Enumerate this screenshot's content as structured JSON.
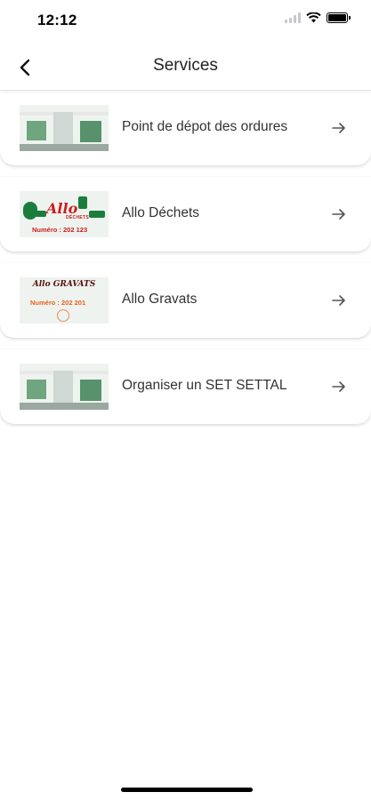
{
  "status_bar": {
    "time": "12:12"
  },
  "nav": {
    "title": "Services"
  },
  "services": [
    {
      "label": "Point de dépot des ordures",
      "icon": "arrow-right-icon"
    },
    {
      "label": "Allo Déchets",
      "icon": "arrow-right-icon",
      "thumb_text": "Allo",
      "thumb_sub": "DÉCHETS",
      "thumb_number": "Numéro : 202 123"
    },
    {
      "label": "Allo Gravats",
      "icon": "arrow-right-icon",
      "thumb_text": "Allo GRAVATS",
      "thumb_number": "Numéro : 202 201"
    },
    {
      "label": "Organiser un SET SETTAL",
      "icon": "arrow-right-icon"
    }
  ],
  "colors": {
    "accent_green": "#2f7d4b",
    "allo_red": "#cc1e1e",
    "gravats_orange": "#e8621c"
  }
}
